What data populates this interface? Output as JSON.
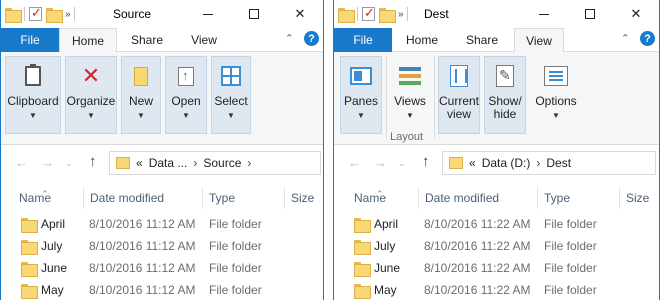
{
  "left": {
    "title": "Source",
    "tabs": {
      "file": "File",
      "home": "Home",
      "share": "Share",
      "view": "View"
    },
    "ribbon": [
      {
        "label": "Clipboard",
        "icon": "clipboard-icon"
      },
      {
        "label": "Organize",
        "icon": "organize-icon"
      },
      {
        "label": "New",
        "icon": "new-icon"
      },
      {
        "label": "Open",
        "icon": "open-icon"
      },
      {
        "label": "Select",
        "icon": "select-icon"
      }
    ],
    "address": {
      "prefix": "«",
      "seg1": "Data ...",
      "seg2": "Source"
    },
    "columns": {
      "name": "Name",
      "date": "Date modified",
      "type": "Type",
      "size": "Size"
    },
    "rows": [
      {
        "name": "April",
        "date": "8/10/2016 11:12 AM",
        "type": "File folder"
      },
      {
        "name": "July",
        "date": "8/10/2016 11:12 AM",
        "type": "File folder"
      },
      {
        "name": "June",
        "date": "8/10/2016 11:12 AM",
        "type": "File folder"
      },
      {
        "name": "May",
        "date": "8/10/2016 11:12 AM",
        "type": "File folder"
      }
    ]
  },
  "right": {
    "title": "Dest",
    "tabs": {
      "file": "File",
      "home": "Home",
      "share": "Share",
      "view": "View"
    },
    "ribbon": [
      {
        "label": "Panes",
        "icon": "panes-icon"
      },
      {
        "label": "Views",
        "icon": "views-icon"
      },
      {
        "label": "Current\nview",
        "icon": "current-view-icon"
      },
      {
        "label": "Show/\nhide",
        "icon": "show-hide-icon"
      },
      {
        "label": "Options",
        "icon": "options-icon"
      }
    ],
    "group_label": "Layout",
    "address": {
      "prefix": "«",
      "seg1": "Data (D:)",
      "seg2": "Dest"
    },
    "columns": {
      "name": "Name",
      "date": "Date modified",
      "type": "Type",
      "size": "Size"
    },
    "rows": [
      {
        "name": "April",
        "date": "8/10/2016 11:22 AM",
        "type": "File folder"
      },
      {
        "name": "July",
        "date": "8/10/2016 11:22 AM",
        "type": "File folder"
      },
      {
        "name": "June",
        "date": "8/10/2016 11:22 AM",
        "type": "File folder"
      },
      {
        "name": "May",
        "date": "8/10/2016 11:22 AM",
        "type": "File folder"
      }
    ]
  },
  "colors": {
    "accent": "#1979ca",
    "ribbon_button": "#dfe8f1",
    "folder": "#f8d775"
  }
}
